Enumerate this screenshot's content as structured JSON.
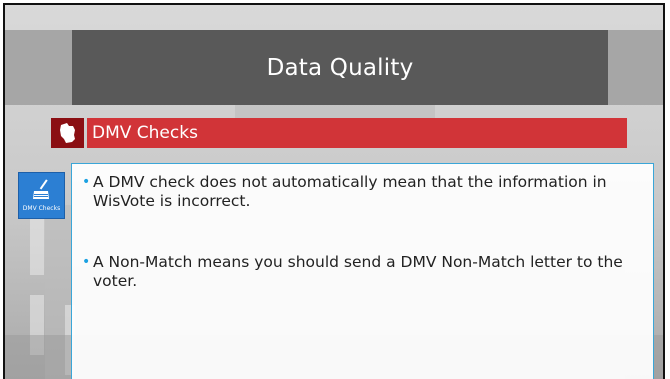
{
  "slide": {
    "title": "Data Quality",
    "section": {
      "label": "DMV Checks",
      "icon": "wisconsin-state-icon"
    },
    "app_tile": {
      "label": "DMV Checks",
      "icon": "broom-icon"
    },
    "bullets": [
      "A DMV check does not automatically mean that the information in WisVote is incorrect.",
      "A Non-Match means you should send a DMV Non-Match letter to the voter."
    ]
  },
  "colors": {
    "title_bar": "#595959",
    "title_side": "#a6a6a6",
    "section_bar": "#d13438",
    "section_icon_bg": "#8b0f13",
    "bullet_accent": "#1ba1e2",
    "tile": "#2c7fd3",
    "content_border": "#3aa6d8"
  }
}
